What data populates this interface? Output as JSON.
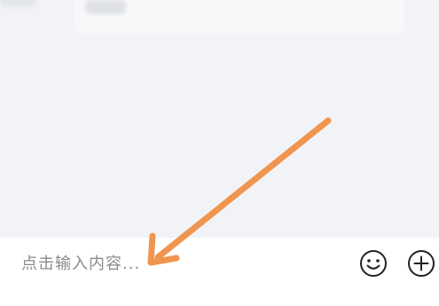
{
  "input": {
    "placeholder": "点击输入内容..."
  },
  "toolbar": {
    "emoji_icon": "smiley-face-icon",
    "plus_icon": "plus-circle-icon"
  },
  "colors": {
    "background": "#f2f3f6",
    "input_bar": "#ffffff",
    "placeholder_text": "#8a8a8a",
    "annotation_arrow": "#f0954f",
    "icon_stroke": "#222222"
  }
}
